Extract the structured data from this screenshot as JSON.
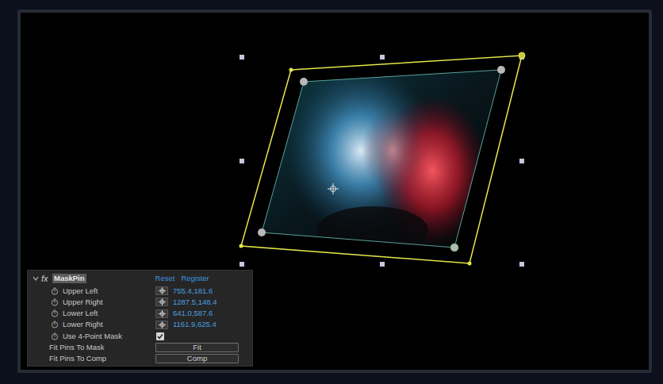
{
  "effect": {
    "twirl_expanded": true,
    "fx_label": "fx",
    "name": "MaskPin",
    "selected": true,
    "header_links": [
      "Reset",
      "Register"
    ],
    "properties": [
      {
        "kind": "point",
        "label": "Upper Left",
        "value": "755.4,181.6"
      },
      {
        "kind": "point",
        "label": "Upper Right",
        "value": "1287.5,148.4"
      },
      {
        "kind": "point",
        "label": "Lower Left",
        "value": "641.0,587.6"
      },
      {
        "kind": "point",
        "label": "Lower Right",
        "value": "1161.9,625.4"
      },
      {
        "kind": "checkbox",
        "label": "Use 4-Point Mask",
        "checked": true
      },
      {
        "kind": "button",
        "label": "Fit Pins To Mask",
        "button": "Fit"
      },
      {
        "kind": "button",
        "label": "Fit Pins To Comp",
        "button": "Comp"
      }
    ]
  }
}
